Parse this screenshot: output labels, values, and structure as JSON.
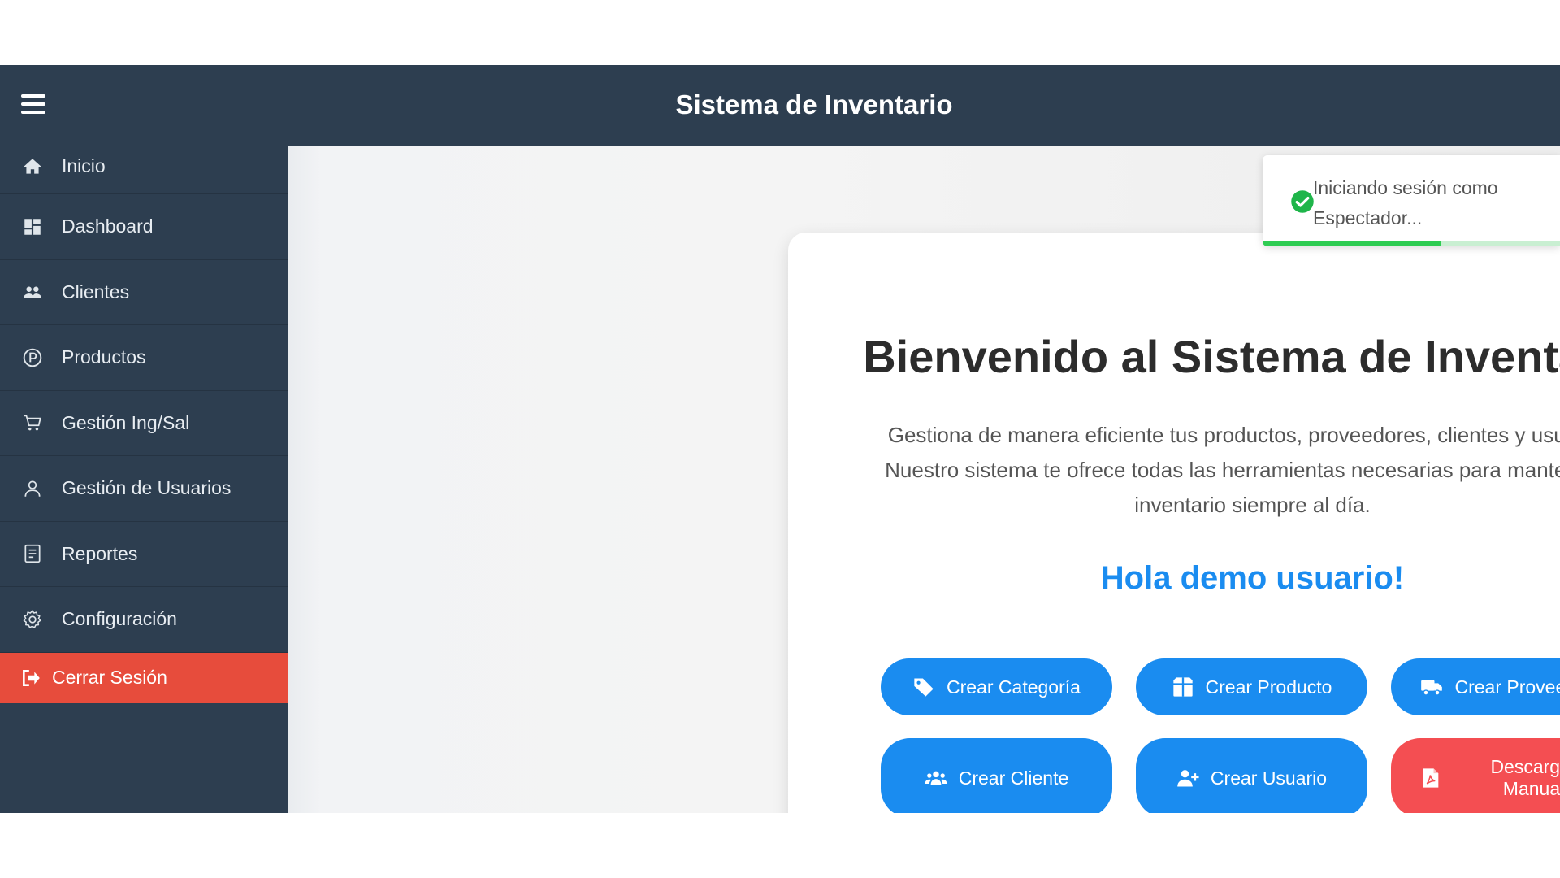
{
  "app": {
    "title": "Sistema de Inventario"
  },
  "sidebar": {
    "items": [
      {
        "label": "Inicio",
        "icon": "home-icon"
      },
      {
        "label": "Dashboard",
        "icon": "dashboard-icon"
      },
      {
        "label": "Clientes",
        "icon": "people-icon"
      },
      {
        "label": "Productos",
        "icon": "product-icon"
      },
      {
        "label": "Gestión Ing/Sal",
        "icon": "cart-icon"
      },
      {
        "label": "Gestión de Usuarios",
        "icon": "user-icon"
      },
      {
        "label": "Reportes",
        "icon": "report-icon"
      },
      {
        "label": "Configuración",
        "icon": "gear-icon"
      }
    ],
    "logout": {
      "label": "Cerrar Sesión",
      "icon": "logout-icon",
      "color": "#e74c3c"
    }
  },
  "welcome": {
    "title": "Bienvenido al Sistema de Inventario",
    "description": "Gestiona de manera eficiente tus productos, proveedores, clientes y usuarios. Nuestro sistema te ofrece todas las herramientas necesarias para mantener tu inventario siempre al día.",
    "greeting": "Hola demo usuario!"
  },
  "actions": {
    "create_category": {
      "label": "Crear Categoría",
      "icon": "tag-icon"
    },
    "create_product": {
      "label": "Crear Producto",
      "icon": "box-icon"
    },
    "create_supplier": {
      "label": "Crear Proveedor",
      "icon": "truck-icon"
    },
    "create_client": {
      "label": "Crear Cliente",
      "icon": "users-icon"
    },
    "create_user": {
      "label": "Crear Usuario",
      "icon": "user-plus-icon"
    },
    "download_manual": {
      "label": "Descargar Manual",
      "icon": "pdf-file-icon"
    }
  },
  "toast": {
    "line1": "Iniciando sesión como",
    "line2": "Espectador...",
    "icon": "check-circle-icon",
    "progress": 0.6
  },
  "colors": {
    "topbar": "#2d3e50",
    "primary": "#1a8cf0",
    "danger": "#f44e52",
    "success": "#2ecc52"
  }
}
